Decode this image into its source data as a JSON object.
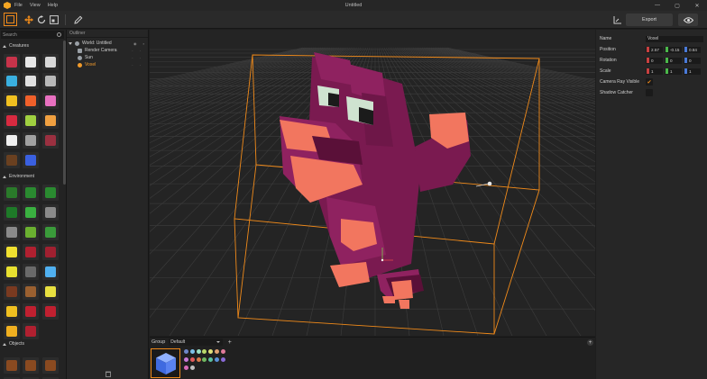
{
  "titlebar": {
    "menus": [
      "File",
      "View",
      "Help"
    ],
    "title": "Untitled",
    "controls": [
      "—",
      "▢",
      "✕"
    ]
  },
  "toolbar": {
    "export_label": "Export"
  },
  "library": {
    "search_placeholder": "Search",
    "sections": [
      "Creatures",
      "Environment",
      "Objects"
    ]
  },
  "outliner": {
    "header": "Outliner",
    "items": [
      {
        "label": "World: Untitled",
        "icon": "globe-icon",
        "color": "#9aa0a6"
      },
      {
        "label": "Render Camera",
        "icon": "camera-icon",
        "color": "#9aa0a6"
      },
      {
        "label": "Sun",
        "icon": "sun-icon",
        "color": "#9aa0a6"
      },
      {
        "label": "Voxel",
        "icon": "voxel-icon",
        "color": "#f29b2b"
      }
    ]
  },
  "properties": {
    "name_label": "Name",
    "name_value": "Voxel",
    "position_label": "Position",
    "position": [
      "2.57",
      "-0.15",
      "0.84"
    ],
    "rotation_label": "Rotation",
    "rotation": [
      "0",
      "0",
      "0"
    ],
    "scale_label": "Scale",
    "scale": [
      "1",
      "1",
      "1"
    ],
    "camera_ray_label": "Camera Ray Visible",
    "camera_ray_checked": true,
    "shadow_catcher_label": "Shadow Catcher",
    "shadow_catcher_checked": false
  },
  "palette": {
    "group_label": "Group",
    "group_value": "Default",
    "swatch_colors": [
      "#6d86c8",
      "#7dc0e8",
      "#9be0c4",
      "#b9d86a",
      "#e0e07a",
      "#e0a070",
      "#e07a9a",
      "#c87ad8",
      "#e05a5a",
      "#d87a4a",
      "#70b860",
      "#5ac0a0",
      "#5a90d8",
      "#8a6ad8",
      "#d86ab8",
      "#c0c0c0"
    ]
  },
  "colors": {
    "accent": "#f08a1a",
    "voxel_body": "#8a1f5a",
    "voxel_highlight": "#f2765f",
    "voxel_eye": "#cfe3d0"
  }
}
